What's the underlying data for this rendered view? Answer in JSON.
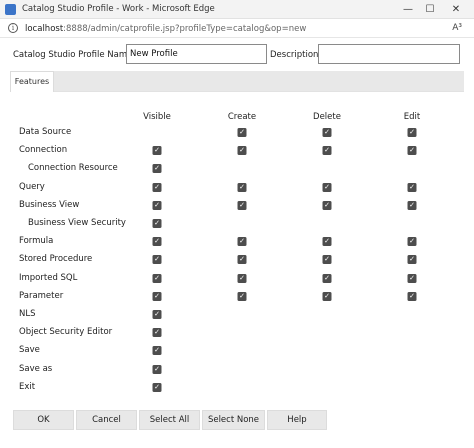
{
  "window": {
    "title": "Catalog Studio Profile - Work - Microsoft Edge",
    "minimize": "—",
    "maximize": "☐",
    "close": "✕"
  },
  "address": {
    "host": "localhost",
    "rest": ":8888/admin/catprofile.jsp?profileType=catalog&op=new",
    "read_aloud": "A³"
  },
  "form": {
    "name_label": "Catalog Studio Profile Name:",
    "name_value": "New Profile",
    "description_label": "Description:",
    "description_value": ""
  },
  "tabs": [
    "Features"
  ],
  "grid": {
    "columns": [
      "Visible",
      "Create",
      "Delete",
      "Edit"
    ],
    "rows": [
      {
        "label": "Data Source",
        "indent": false,
        "checks": [
          false,
          true,
          true,
          true
        ]
      },
      {
        "label": "Connection",
        "indent": false,
        "checks": [
          true,
          true,
          true,
          true
        ]
      },
      {
        "label": "Connection Resource",
        "indent": true,
        "checks": [
          true,
          false,
          false,
          false
        ]
      },
      {
        "label": "Query",
        "indent": false,
        "checks": [
          true,
          true,
          true,
          true
        ]
      },
      {
        "label": "Business View",
        "indent": false,
        "checks": [
          true,
          true,
          true,
          true
        ]
      },
      {
        "label": "Business View Security",
        "indent": true,
        "checks": [
          true,
          false,
          false,
          false
        ]
      },
      {
        "label": "Formula",
        "indent": false,
        "checks": [
          true,
          true,
          true,
          true
        ]
      },
      {
        "label": "Stored Procedure",
        "indent": false,
        "checks": [
          true,
          true,
          true,
          true
        ]
      },
      {
        "label": "Imported SQL",
        "indent": false,
        "checks": [
          true,
          true,
          true,
          true
        ]
      },
      {
        "label": "Parameter",
        "indent": false,
        "checks": [
          true,
          true,
          true,
          true
        ]
      },
      {
        "label": "NLS",
        "indent": false,
        "checks": [
          true,
          false,
          false,
          false
        ]
      },
      {
        "label": "Object Security Editor",
        "indent": false,
        "checks": [
          true,
          false,
          false,
          false
        ]
      },
      {
        "label": "Save",
        "indent": false,
        "checks": [
          true,
          false,
          false,
          false
        ]
      },
      {
        "label": "Save as",
        "indent": false,
        "checks": [
          true,
          false,
          false,
          false
        ]
      },
      {
        "label": "Exit",
        "indent": false,
        "checks": [
          true,
          false,
          false,
          false
        ]
      }
    ]
  },
  "buttons": [
    "OK",
    "Cancel",
    "Select All",
    "Select None",
    "Help"
  ]
}
